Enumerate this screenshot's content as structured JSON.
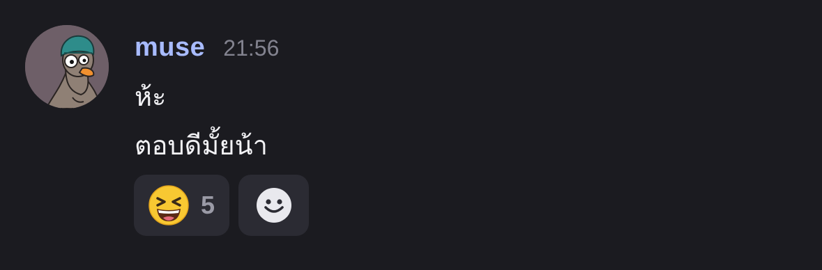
{
  "message": {
    "author": "muse",
    "time": "21:56",
    "lines": [
      "ห้ะ",
      "ตอบดีมั้ยน้า"
    ]
  },
  "avatar": {
    "icon": "duck-avatar-icon"
  },
  "reactions": [
    {
      "emoji": "😆",
      "icon": "laughing-emoji-icon",
      "count": "5"
    }
  ],
  "add_reaction": {
    "icon": "smiley-add-reaction-icon"
  },
  "colors": {
    "background": "#1b1b20",
    "username": "#a8bbff",
    "timestamp": "#83838f",
    "text": "#f2f2f5",
    "reaction_bg": "#2b2b33"
  }
}
